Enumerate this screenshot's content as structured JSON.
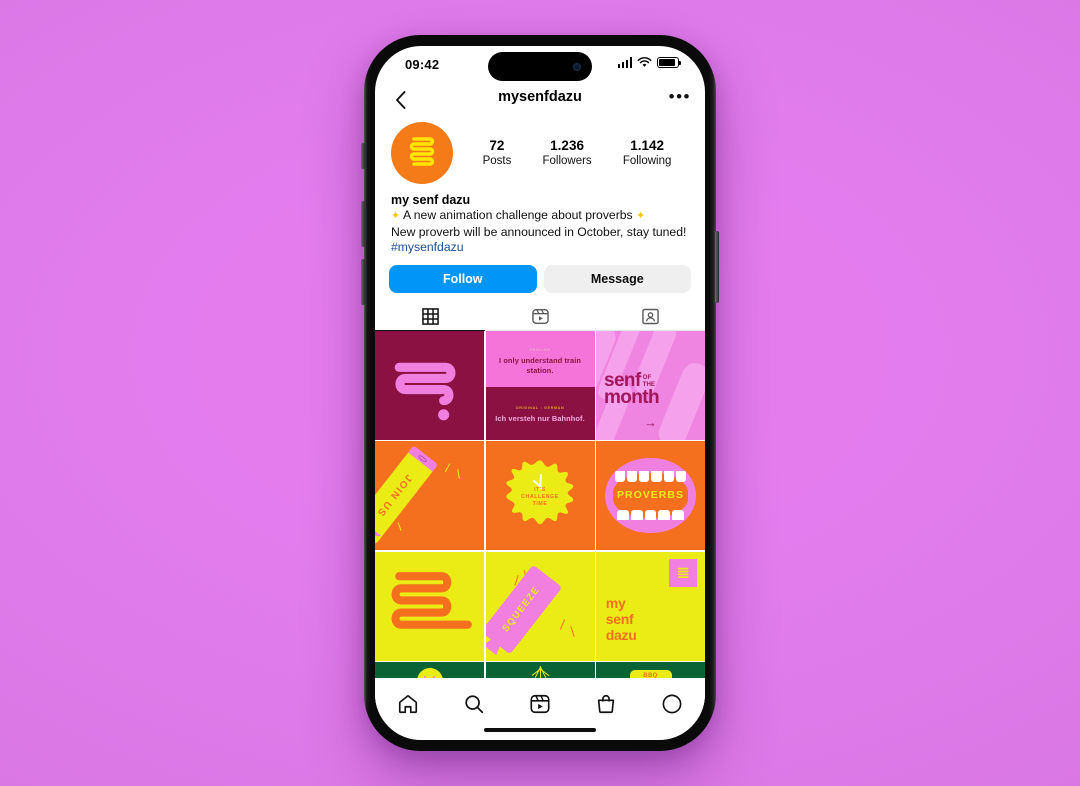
{
  "status_bar": {
    "time": "09:42",
    "signal_icon": "cellular-bars-icon",
    "wifi_icon": "wifi-icon",
    "battery_icon": "battery-icon"
  },
  "header": {
    "back_icon": "chevron-left-icon",
    "username": "mysenfdazu",
    "more_label": "•••"
  },
  "profile": {
    "avatar_name": "profile-avatar-squiggle",
    "display_name": "my senf dazu",
    "stats": [
      {
        "num": "72",
        "label": "Posts"
      },
      {
        "num": "1.236",
        "label": "Followers"
      },
      {
        "num": "1.142",
        "label": "Following"
      }
    ],
    "bio_line_1": "A new animation challenge about proverbs",
    "bio_line_2": "New proverb will be announced in October, stay tuned!",
    "hashtag": "#mysenfdazu",
    "sparkle_glyph": "✦",
    "follow_label": "Follow",
    "message_label": "Message",
    "follow_color": "#0095F6",
    "message_color": "#EFEFEF"
  },
  "tabs": [
    {
      "name": "grid",
      "icon": "grid-icon",
      "active": true
    },
    {
      "name": "reels",
      "icon": "reels-icon",
      "active": false
    },
    {
      "name": "tagged",
      "icon": "tagged-person-icon",
      "active": false
    }
  ],
  "grid": {
    "tile1": {
      "name": "maroon-squiggle-post",
      "bg": "#8C1143",
      "accent": "#F07FE0"
    },
    "tile2": {
      "name": "proverb-translation-post",
      "label_en": "ENGLISH",
      "quote_en": "I only understand train station.",
      "label_de": "ORIGINAL : GERMAN",
      "quote_de": "Ich versteh nur Bahnhof.",
      "bg_top": "#F474D9",
      "bg_bottom": "#8C1143"
    },
    "tile3": {
      "name": "senf-of-the-month-post",
      "word1": "senf",
      "word_of": "OF",
      "word_the": "THE",
      "word2": "month",
      "arrow": "→",
      "bg": "#EF85E0"
    },
    "tile4": {
      "name": "join-us-pencil-post",
      "text": "JOIN US",
      "bg": "#F4701F"
    },
    "tile5": {
      "name": "challenge-time-post",
      "line1": "IT'S",
      "line2": "CHALLENGE",
      "line3": "TIME",
      "bg": "#F4701F"
    },
    "tile6": {
      "name": "proverbs-mouth-post",
      "text": "PROVERBS",
      "bg": "#F4701F"
    },
    "tile7": {
      "name": "mustard-coil-post",
      "bg": "#EBEB16"
    },
    "tile8": {
      "name": "squeeze-tube-post",
      "text": "SQUEEZE",
      "bg": "#EBEB16"
    },
    "tile9": {
      "name": "my-senf-dazu-post",
      "line1": "my",
      "line2": "senf",
      "line3": "dazu",
      "bg": "#EBEB16"
    },
    "tile10": {
      "name": "green-smiley-post",
      "bg": "#0A6334"
    },
    "tile11": {
      "name": "green-rays-post",
      "bg": "#0A6334"
    },
    "tile12": {
      "name": "green-label-post",
      "text": "BBQ",
      "bg": "#0A6334"
    }
  },
  "bottom_nav": [
    {
      "name": "home",
      "icon": "home-icon"
    },
    {
      "name": "search",
      "icon": "search-icon"
    },
    {
      "name": "reels",
      "icon": "reels-icon"
    },
    {
      "name": "shop",
      "icon": "shop-bag-icon"
    },
    {
      "name": "profile",
      "icon": "profile-circle-icon"
    }
  ]
}
